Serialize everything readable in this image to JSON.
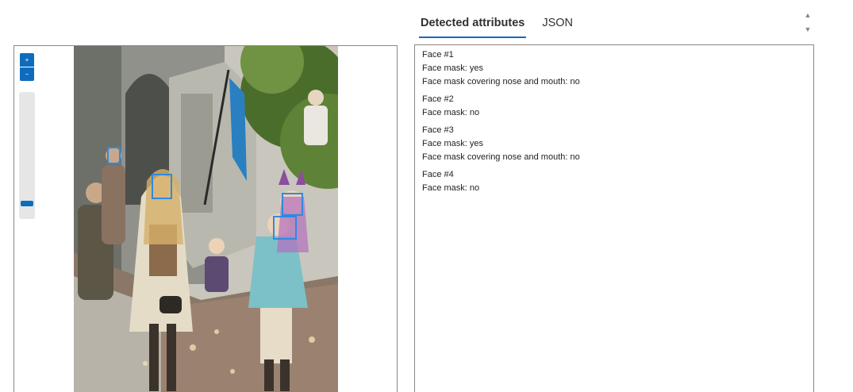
{
  "tabs": [
    {
      "label": "Detected attributes",
      "active": true
    },
    {
      "label": "JSON",
      "active": false
    }
  ],
  "viewer": {
    "zoom_in_icon": "zoom-in-icon",
    "zoom_out_icon": "zoom-out-icon",
    "zoom_level": 0.05,
    "image_description_icon": "illustrated-street-scene",
    "faces_detected": 4
  },
  "spinner": {
    "up_icon": "chevron-up-icon",
    "down_icon": "chevron-down-icon"
  },
  "results": {
    "faces": [
      {
        "title": "Face #1",
        "lines": [
          "Face mask: yes",
          "Face mask covering nose and mouth: no"
        ]
      },
      {
        "title": "Face #2",
        "lines": [
          "Face mask: no"
        ]
      },
      {
        "title": "Face #3",
        "lines": [
          "Face mask: yes",
          "Face mask covering nose and mouth: no"
        ]
      },
      {
        "title": "Face #4",
        "lines": [
          "Face mask: no"
        ]
      }
    ]
  },
  "colors": {
    "accent": "#0f6cbd",
    "face_box": "#2f8ae0",
    "border": "#8a8886"
  }
}
